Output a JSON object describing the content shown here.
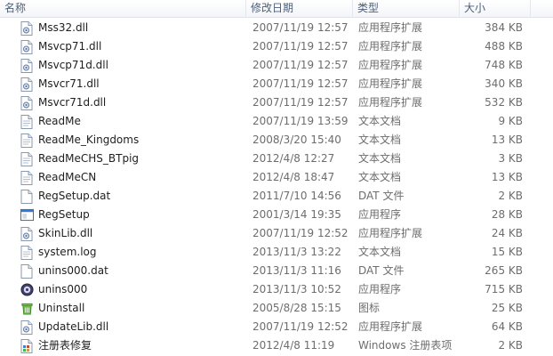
{
  "columns": {
    "name": "名称",
    "date": "修改日期",
    "type": "类型",
    "size": "大小"
  },
  "files": [
    {
      "name": "Mss32.dll",
      "date": "2007/11/19 12:57",
      "type": "应用程序扩展",
      "size": "384 KB",
      "icon": "dll-file-icon"
    },
    {
      "name": "Msvcp71.dll",
      "date": "2007/11/19 12:57",
      "type": "应用程序扩展",
      "size": "488 KB",
      "icon": "dll-file-icon"
    },
    {
      "name": "Msvcp71d.dll",
      "date": "2007/11/19 12:57",
      "type": "应用程序扩展",
      "size": "748 KB",
      "icon": "dll-file-icon"
    },
    {
      "name": "Msvcr71.dll",
      "date": "2007/11/19 12:57",
      "type": "应用程序扩展",
      "size": "340 KB",
      "icon": "dll-file-icon"
    },
    {
      "name": "Msvcr71d.dll",
      "date": "2007/11/19 12:57",
      "type": "应用程序扩展",
      "size": "532 KB",
      "icon": "dll-file-icon"
    },
    {
      "name": "ReadMe",
      "date": "2007/11/19 13:59",
      "type": "文本文档",
      "size": "9 KB",
      "icon": "text-file-icon"
    },
    {
      "name": "ReadMe_Kingdoms",
      "date": "2008/3/20 15:40",
      "type": "文本文档",
      "size": "13 KB",
      "icon": "text-file-icon"
    },
    {
      "name": "ReadMeCHS_BTpig",
      "date": "2012/4/8 12:27",
      "type": "文本文档",
      "size": "3 KB",
      "icon": "text-file-icon"
    },
    {
      "name": "ReadMeCN",
      "date": "2012/4/8 18:47",
      "type": "文本文档",
      "size": "13 KB",
      "icon": "text-file-icon"
    },
    {
      "name": "RegSetup.dat",
      "date": "2011/7/10 14:56",
      "type": "DAT 文件",
      "size": "2 KB",
      "icon": "blank-file-icon"
    },
    {
      "name": "RegSetup",
      "date": "2001/3/14 19:35",
      "type": "应用程序",
      "size": "28 KB",
      "icon": "application-icon"
    },
    {
      "name": "SkinLib.dll",
      "date": "2007/11/19 12:52",
      "type": "应用程序扩展",
      "size": "24 KB",
      "icon": "dll-file-icon"
    },
    {
      "name": "system.log",
      "date": "2013/11/3 13:22",
      "type": "文本文档",
      "size": "15 KB",
      "icon": "text-file-icon"
    },
    {
      "name": "unins000.dat",
      "date": "2013/11/3 11:16",
      "type": "DAT 文件",
      "size": "265 KB",
      "icon": "blank-file-icon"
    },
    {
      "name": "unins000",
      "date": "2013/11/3 10:52",
      "type": "应用程序",
      "size": "715 KB",
      "icon": "uninstaller-icon"
    },
    {
      "name": "Uninstall",
      "date": "2005/8/28 15:15",
      "type": "图标",
      "size": "25 KB",
      "icon": "recycle-icon"
    },
    {
      "name": "UpdateLib.dll",
      "date": "2007/11/19 12:52",
      "type": "应用程序扩展",
      "size": "64 KB",
      "icon": "dll-file-icon"
    },
    {
      "name": "注册表修复",
      "date": "2012/4/8 11:19",
      "type": "Windows 注册表项",
      "size": "2 KB",
      "icon": "registry-file-icon"
    }
  ],
  "colors": {
    "header_text": "#4c607a",
    "name_text": "#1e1e1e",
    "detail_text": "#6d6d6d"
  }
}
